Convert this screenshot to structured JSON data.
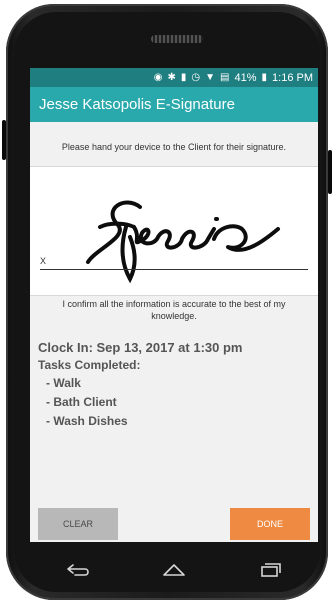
{
  "status": {
    "icons": [
      "location-icon",
      "bluetooth-icon",
      "vibrate-icon",
      "alarm-icon",
      "wifi-icon",
      "signal-icon"
    ],
    "battery": "41%",
    "time": "1:16 PM"
  },
  "appbar": {
    "title": "Jesse Katsopolis E-Signature"
  },
  "instruction": "Please hand your device to the Client for their signature.",
  "signature": {
    "x_label": "X",
    "name_drawn": "Jessie"
  },
  "confirm_text": "I confirm all the information is accurate to the best of my knowledge.",
  "details": {
    "clock_in": "Clock In: Sep 13, 2017 at 1:30 pm",
    "tasks_title": "Tasks Completed:",
    "tasks": [
      "- Walk",
      "- Bath Client",
      "- Wash Dishes"
    ]
  },
  "buttons": {
    "clear": "CLEAR",
    "done": "DONE"
  },
  "colors": {
    "statusbar": "#1f7e80",
    "appbar": "#2aa9ac",
    "done": "#ee8a41",
    "clear": "#b8b8b8"
  }
}
